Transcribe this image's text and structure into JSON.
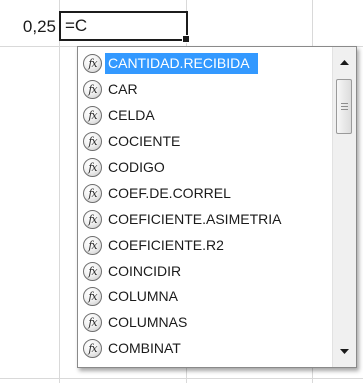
{
  "sheet": {
    "prior_cell_value": "0,25",
    "active_cell_formula": "=C"
  },
  "autocomplete": {
    "items": [
      {
        "label": "CANTIDAD.RECIBIDA",
        "icon": "function-icon",
        "selected": true
      },
      {
        "label": "CAR",
        "icon": "function-icon"
      },
      {
        "label": "CELDA",
        "icon": "function-icon"
      },
      {
        "label": "COCIENTE",
        "icon": "function-icon"
      },
      {
        "label": "CODIGO",
        "icon": "function-icon"
      },
      {
        "label": "COEF.DE.CORREL",
        "icon": "function-icon"
      },
      {
        "label": "COEFICIENTE.ASIMETRIA",
        "icon": "function-icon"
      },
      {
        "label": "COEFICIENTE.R2",
        "icon": "function-icon"
      },
      {
        "label": "COINCIDIR",
        "icon": "function-icon"
      },
      {
        "label": "COLUMNA",
        "icon": "function-icon"
      },
      {
        "label": "COLUMNAS",
        "icon": "function-icon"
      },
      {
        "label": "COMBINAT",
        "icon": "function-icon"
      }
    ],
    "icon_glyph": "fx",
    "selection_color": "#3399ff",
    "scroll_up_icon": "triangle-up-icon",
    "scroll_down_icon": "triangle-down-icon"
  }
}
